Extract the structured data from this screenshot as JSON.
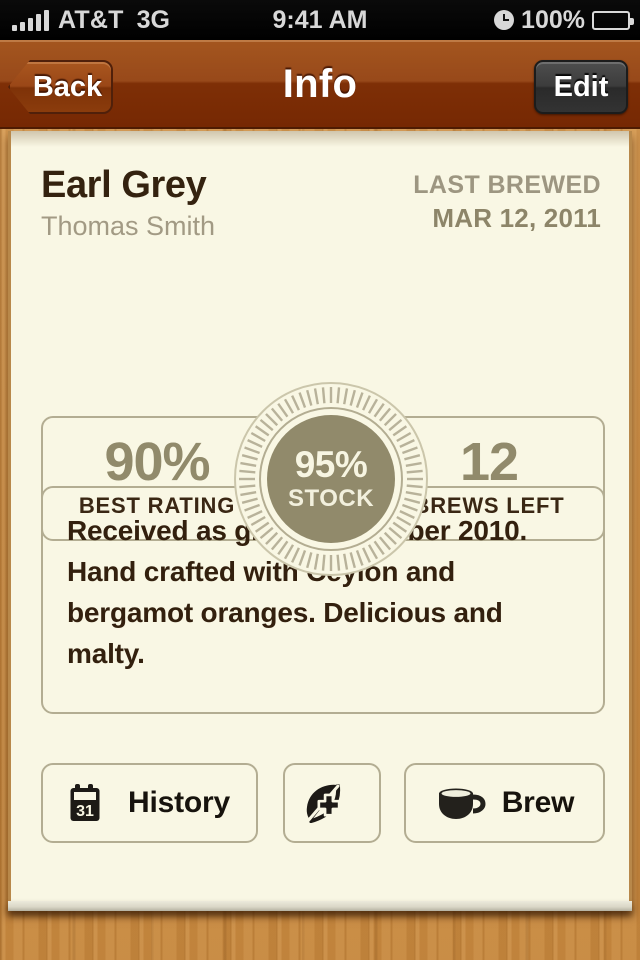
{
  "status_bar": {
    "signal_icon": "signal-bars-icon",
    "signal_bars": 5,
    "carrier": "AT&T",
    "network": "3G",
    "time": "9:41 AM",
    "alarm_icon": "alarm-clock-icon",
    "battery_percent": "100%",
    "battery_icon": "battery-full-icon"
  },
  "nav_bar": {
    "back_label": "Back",
    "title": "Info",
    "edit_label": "Edit",
    "back_icon": "chevron-left-icon"
  },
  "tea": {
    "name": "Earl Grey",
    "vendor": "Thomas Smith",
    "last_brewed_label": "LAST BREWED",
    "last_brewed_date": "MAR 12, 2011"
  },
  "stats": {
    "left": {
      "value": "90%",
      "label": "BEST RATING"
    },
    "right": {
      "value": "12",
      "label": "BREWS LEFT"
    },
    "badge": {
      "value": "95%",
      "label": "STOCK",
      "icon": "stock-badge-icon"
    }
  },
  "notes": {
    "text": "Received as gift in December 2010. Hand crafted with Ceylon and bergamot oranges. Delicious and malty."
  },
  "actions": [
    {
      "label": "History",
      "icon": "calendar-icon",
      "icon_day": "31"
    },
    {
      "label": "",
      "icon": "leaf-plus-icon"
    },
    {
      "label": "Brew",
      "icon": "teacup-icon"
    }
  ],
  "colors": {
    "paper": "#f9f7e4",
    "nav_top": "#a4561f",
    "nav_bottom": "#762803",
    "olive": "#918a6b",
    "dark_brown": "#34220f",
    "rule": "#b3ad92",
    "wood": "#d39a52"
  }
}
